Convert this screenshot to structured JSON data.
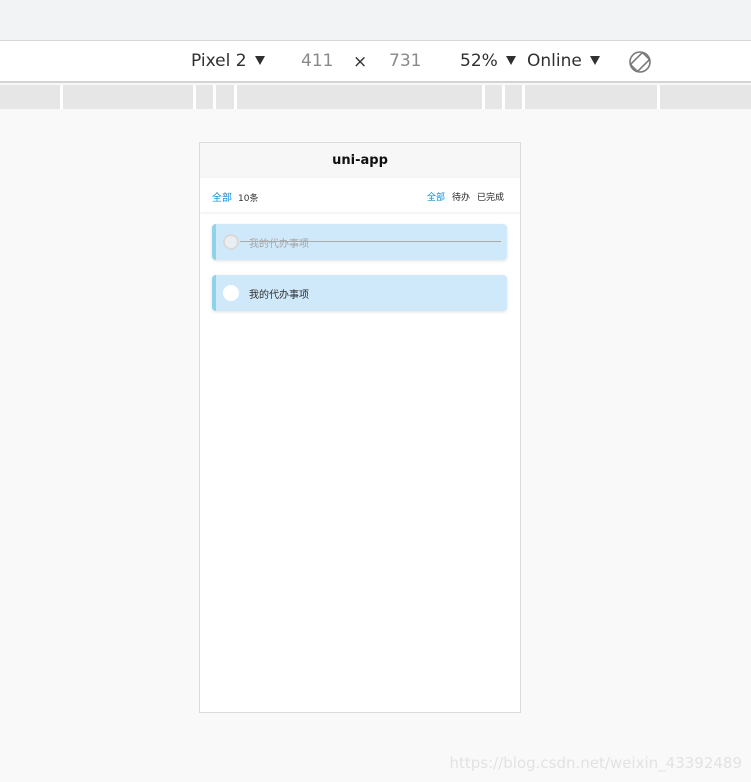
{
  "device_toolbar": {
    "device": "Pixel 2",
    "width": "411",
    "times": "×",
    "height": "731",
    "zoom": "52%",
    "network": "Online"
  },
  "app": {
    "title": "uni-app",
    "filter": {
      "selected_label": "全部",
      "count_label": "10条",
      "tabs": [
        "全部",
        "待办",
        "已完成"
      ],
      "active_tab": "全部"
    },
    "todos": [
      {
        "text": "我的代办事项",
        "completed": true
      },
      {
        "text": "我的代办事项",
        "completed": false
      }
    ]
  },
  "watermark": "https://blog.csdn.net/weixin_43392489",
  "colors": {
    "accent": "#0f8dd8",
    "todo_bg": "#cfe9fb",
    "todo_border": "#8fd3ea"
  }
}
